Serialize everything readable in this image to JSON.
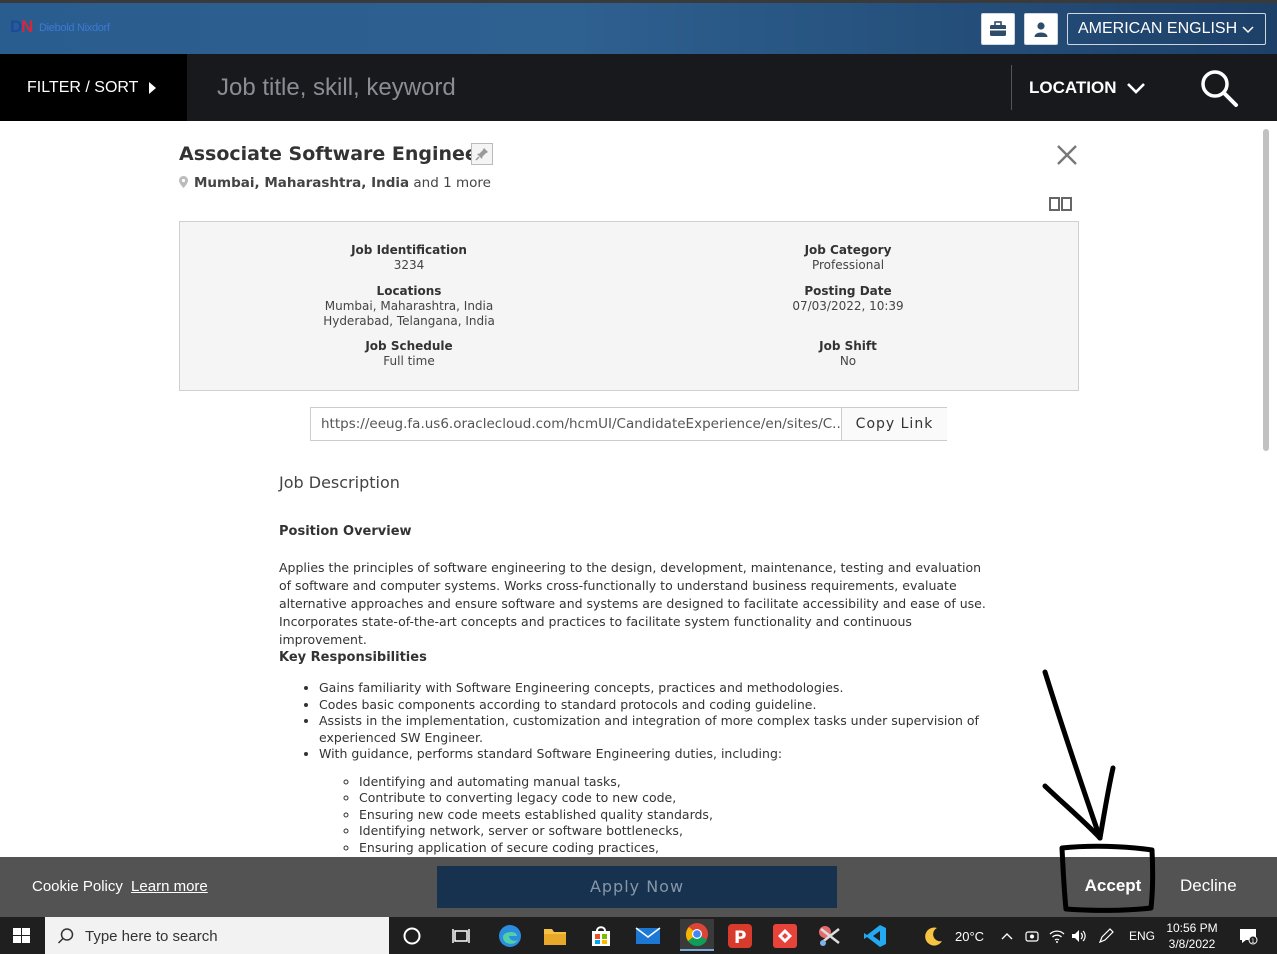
{
  "header": {
    "brand": "Diebold Nixdorf",
    "language": "AMERICAN ENGLISH"
  },
  "search": {
    "filter_label": "FILTER / SORT",
    "keyword_placeholder": "Job title, skill, keyword",
    "location_label": "LOCATION"
  },
  "job": {
    "title": "Associate Software Engineer",
    "location_primary": "Mumbai, Maharashtra, India",
    "location_more": "and 1 more",
    "details": {
      "id_label": "Job Identification",
      "id_value": "3234",
      "category_label": "Job Category",
      "category_value": "Professional",
      "locations_label": "Locations",
      "locations_values": [
        "Mumbai, Maharashtra, India",
        "Hyderabad, Telangana, India"
      ],
      "posting_label": "Posting Date",
      "posting_value": "07/03/2022, 10:39",
      "schedule_label": "Job Schedule",
      "schedule_value": "Full time",
      "shift_label": "Job Shift",
      "shift_value": "No"
    },
    "share_link": "https://eeug.fa.us6.oraclecloud.com/hcmUI/CandidateExperience/en/sites/C...",
    "copy_label": "Copy Link",
    "description_heading": "Job Description",
    "overview_heading": "Position Overview",
    "overview_text": "Applies the principles of software engineering to the design, development, maintenance, testing and evaluation of software and computer systems. Works cross-functionally to understand business requirements, evaluate alternative approaches and ensure software and systems are designed to facilitate accessibility and ease of use. Incorporates state-of-the-art concepts and practices to facilitate system functionality and continuous improvement.",
    "responsibilities_heading": "Key Responsibilities",
    "responsibilities": [
      "Gains familiarity with Software Engineering concepts, practices and methodologies.",
      "Codes basic components according to standard protocols and coding guideline.",
      "Assists in the implementation, customization and integration of more complex tasks under supervision of experienced SW Engineer.",
      "With guidance, performs standard Software Engineering duties, including:"
    ],
    "sub_duties": [
      "Identifying and automating manual tasks,",
      "Contribute to converting legacy code to new code,",
      "Ensuring new code meets established quality standards,",
      "Identifying network, server or software bottlenecks,",
      "Ensuring application of secure coding practices,"
    ]
  },
  "cookie": {
    "policy_label": "Cookie Policy",
    "learn_more": "Learn more",
    "apply_label": "Apply Now",
    "accept_label": "Accept",
    "decline_label": "Decline"
  },
  "taskbar": {
    "search_placeholder": "Type here to search",
    "temperature": "20°C",
    "language": "ENG",
    "time": "10:56 PM",
    "date": "3/8/2022",
    "notification_count": "1"
  },
  "icons": {
    "briefcase": "briefcase-icon",
    "user": "user-icon",
    "search": "search-icon",
    "close": "close-icon",
    "pin": "pin-icon",
    "location": "location-pin-icon",
    "compare": "compare-icon"
  },
  "colors": {
    "brandbar": "#2a5d8f",
    "searchbar": "#17191d",
    "apply_button": "#17324f",
    "cookie_bar": "#464646"
  }
}
